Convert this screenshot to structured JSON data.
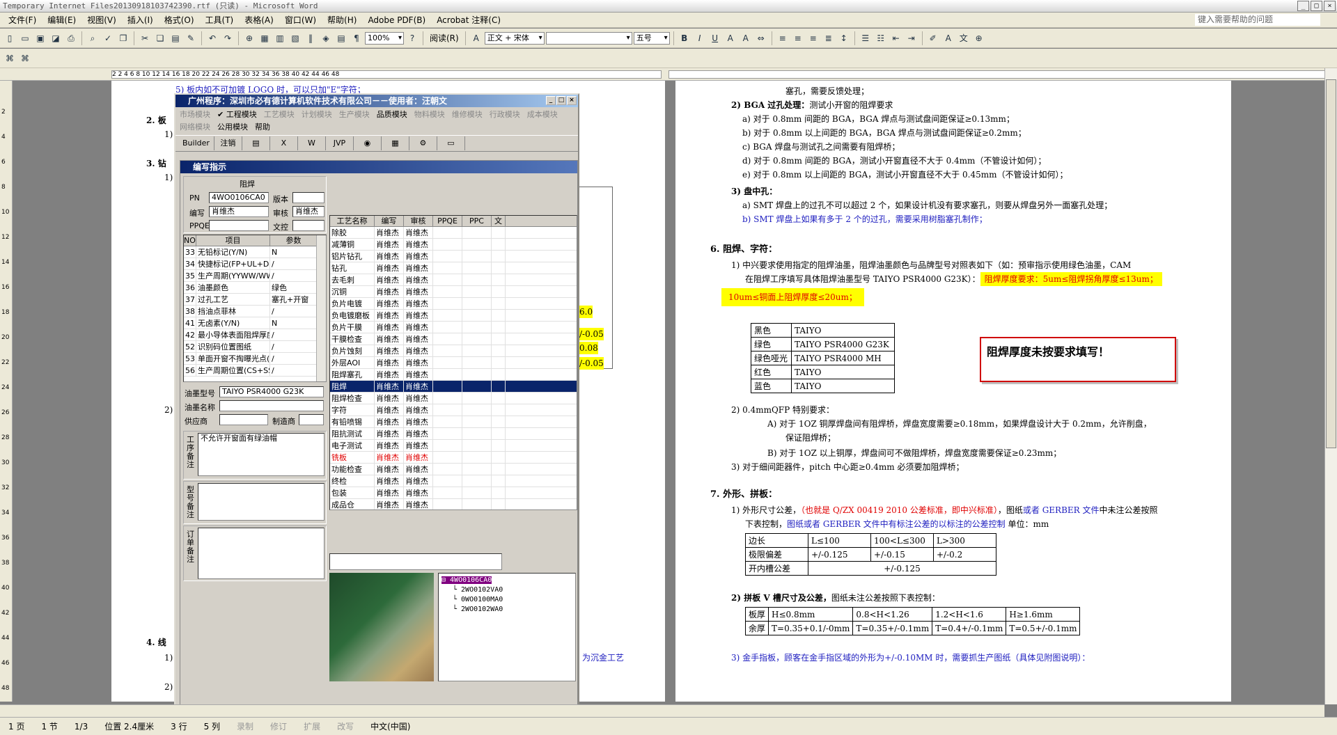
{
  "window": {
    "title": "Temporary Internet Files20130918103742390.rtf (只读) - Microsoft Word",
    "help_placeholder": "键入需要帮助的问题"
  },
  "menu": [
    "文件(F)",
    "编辑(E)",
    "视图(V)",
    "插入(I)",
    "格式(O)",
    "工具(T)",
    "表格(A)",
    "窗口(W)",
    "帮助(H)",
    "Adobe PDF(B)",
    "Acrobat 注释(C)"
  ],
  "toolbar": {
    "zoom": "100%",
    "read": "阅读(R)",
    "style": "正文 + 宋体",
    "font": "",
    "size": "五号"
  },
  "ruler_numbers": "2   2   4   6   8   10  12  14  16  18  20  22  24  26  28  30  32  34  36  38  40  42  44  46  48",
  "vruler": [
    "2",
    "4",
    "6",
    "8",
    "10",
    "12",
    "14",
    "16",
    "18",
    "20",
    "22",
    "24",
    "26",
    "28",
    "30",
    "32",
    "34",
    "36",
    "38",
    "40",
    "42",
    "44",
    "46",
    "48"
  ],
  "left_page": {
    "lines": [
      "5) 板内如不可加镀 LOGO 时，可以只加\"E\"字符；",
      "2. 板",
      "1)",
      "3. 钻",
      "1)",
      "2)",
      "4. 线",
      "1)",
      "2)"
    ],
    "tail": "为沉金工艺",
    "frag": [
      "6.0",
      "/-0.05",
      "0.08",
      "/-0.05"
    ]
  },
  "right_page": {
    "l1": "塞孔，需要反馈处理；",
    "l2a": "2)  BGA 过孔处理：",
    "l2b": "测试小开窗的阻焊要求",
    "l3": "a) 对于 0.8mm 间距的 BGA，BGA 焊点与测试盘间距保证≥0.13mm；",
    "l4": "b) 对于 0.8mm 以上间距的 BGA，BGA 焊点与测试盘间距保证≥0.2mm；",
    "l5": "c) BGA 焊盘与测试孔之间需要有阻焊桥；",
    "l6": "d) 对于 0.8mm 间距的 BGA，测试小开窗直径不大于 0.4mm（不管设计如何）；",
    "l7": "e) 对于 0.8mm 以上间距的 BGA，测试小开窗直径不大于 0.45mm（不管设计如何）；",
    "l8": "3)  盘中孔：",
    "l9": "a) SMT 焊盘上的过孔不可以超过 2 个，如果设计机没有要求塞孔，则要从焊盘另外一面塞孔处理；",
    "l10": "b) SMT 焊盘上如果有多于 2 个的过孔，需要采用树脂塞孔制作；",
    "h6": "6.  阻焊、字符：",
    "l11": "1)  中兴要求使用指定的阻焊油墨，阻焊油墨颜色与品牌型号对照表如下（如：预审指示使用绿色油墨，CAM",
    "l12a": "在阻焊工序填写具体阻焊油墨型号 TAIYO  PSR4000 G23K）：",
    "l12b": "阻焊厚度要求：5um≤阻焊拐角厚度≤13um；",
    "l13": "10um≤铜面上阻焊厚度≤20um；",
    "ink_table": [
      [
        "黑色",
        "TAIYO"
      ],
      [
        "绿色",
        "TAIYO   PSR4000 G23K"
      ],
      [
        "绿色哑光",
        "TAIYO   PSR4000 MH"
      ],
      [
        "红色",
        "TAIYO"
      ],
      [
        "蓝色",
        "TAIYO"
      ]
    ],
    "callout": "阻焊厚度未按要求填写！",
    "l14": "2)  0.4mmQFP 特别要求：",
    "l15": "A) 对于 1OZ 铜厚焊盘间有阻焊桥，焊盘宽度需要≥0.18mm，如果焊盘设计大于 0.2mm，允许削盘，",
    "l16": "保证阻焊桥；",
    "l17": "B) 对于 1OZ 以上铜厚，焊盘间可不做阻焊桥，焊盘宽度需要保证≥0.23mm；",
    "l18": "3)  对于细间距器件，pitch 中心距≥0.4mm 必须要加阻焊桥；",
    "h7": "7.  外形、拼板：",
    "l19a": "1)  外形尺寸公差，",
    "l19b": "（也就是 Q/ZX 00419 2010 公差标准，即中兴标准）",
    "l19c": "，图纸",
    "l19d": "或者 GERBER 文件",
    "l19e": "中未注公差按照",
    "l20a": "下表控制，",
    "l20b": "图纸或者 GERBER 文件中有标注公差的以标注的公差控制",
    "l20c": "  单位：mm",
    "tol_table": [
      [
        "边长",
        "L≤100",
        "100<L≤300",
        "L>300"
      ],
      [
        "极限偏差",
        "+/-0.125",
        "+/-0.15",
        "+/-0.2"
      ],
      [
        "开内槽公差",
        "+/-0.125"
      ]
    ],
    "l21a": "2)  拼板 V 槽尺寸及公差，",
    "l21b": "图纸未注公差按照下表控制：",
    "v_table": [
      [
        "板厚",
        "H≤0.8mm",
        "0.8<H<1.26",
        "1.2<H<1.6",
        "H≥1.6mm"
      ],
      [
        "余厚",
        "T=0.35+0.1/-0mm",
        "T=0.35+/-0.1mm",
        "T=0.4+/-0.1mm",
        "T=0.5+/-0.1mm"
      ]
    ],
    "l22": "3)  金手指板，顾客在金手指区域的外形为+/-0.10MM 时，需要抓生产图纸（具体见附图说明）："
  },
  "dialog": {
    "title": "广州程序：深圳市必有德计算机软件技术有限公司－－使用者：汪朝文",
    "menu": [
      [
        "市场模块",
        false
      ],
      [
        "✔ 工程模块",
        true
      ],
      [
        "工艺模块",
        false
      ],
      [
        "计划模块",
        false
      ],
      [
        "生产模块",
        false
      ],
      [
        "品质模块",
        true
      ],
      [
        "物料模块",
        false
      ],
      [
        "维修模块",
        false
      ],
      [
        "行政模块",
        false
      ],
      [
        "成本模块",
        false
      ],
      [
        "网络模块",
        false
      ],
      [
        "公用模块",
        true
      ],
      [
        "帮助",
        true
      ]
    ],
    "tools": [
      "Builder",
      "注销",
      "▤",
      "X",
      "W",
      "JVP",
      "◉",
      "▦",
      "⚙",
      "▭"
    ],
    "sub_title": "编写指示",
    "section": "阻焊",
    "pn_label": "PN",
    "pn": "4WO0106CA0",
    "ver_label": "版本",
    "ver": "",
    "author_label": "编写",
    "author": "肖维杰",
    "review_label": "审核",
    "review": "肖维杰",
    "ppqe_label": "PPQE",
    "ppqe": "",
    "doc_label": "文控",
    "doc": "",
    "params_hdr": [
      "NO",
      "项目",
      "参数"
    ],
    "params": [
      [
        "33",
        "无铅标记(Y/N)",
        "N"
      ],
      [
        "34",
        "快捷标记(FP+UL+DateCo",
        "/"
      ],
      [
        "35",
        "生产周期(YYWW/WWYY)",
        "/"
      ],
      [
        "36",
        "油墨颜色",
        "绿色"
      ],
      [
        "37",
        "过孔工艺",
        "塞孔+开窗"
      ],
      [
        "38",
        "挡油点菲林",
        "/"
      ],
      [
        "41",
        "无卤素(Y/N)",
        "N"
      ],
      [
        "42",
        "最小导体表面阻焊厚度",
        "/"
      ],
      [
        "52",
        "识别码位置图纸",
        "/"
      ],
      [
        "53",
        "单面开窗不掏曝光点(CS",
        "/"
      ],
      [
        "56",
        "生产周期位置(CS+SS)",
        "/"
      ]
    ],
    "ink_label": "油墨型号",
    "ink": "TAIYO   PSR4000 G23K",
    "inkname_label": "油墨名称",
    "inkname": "",
    "supplier_label": "供应商",
    "maker_label": "制造商",
    "note1_label": "工序备注",
    "note1": "不允许开窗面有绿油帽",
    "note2_label": "型号备注",
    "note3_label": "订单备注",
    "proc_hdr": [
      "工艺名称",
      "编写",
      "审核",
      "PPQE",
      "PPC",
      "文"
    ],
    "procs": [
      "除胶",
      "减薄铜",
      "铝片钻孔",
      "钻孔",
      "去毛刺",
      "沉铜",
      "负片电镀",
      "负电镀磨板",
      "负片干膜",
      "干膜检查",
      "负片蚀刻",
      "外层AOI",
      "阻焊塞孔",
      "阻焊",
      "阻焊检查",
      "字符",
      "有铅喷锡",
      "阻抗测试",
      "电子测试",
      "铣板",
      "功能检查",
      "终检",
      "包装",
      "成品仓"
    ],
    "proc_person": "肖维杰",
    "tree": [
      "4WO0106CA0",
      "2WO0102VA0",
      "0WO0100MA0",
      "2WO0102WA0"
    ]
  },
  "status": [
    "1 页",
    "1 节",
    "1/3",
    "位置 2.4厘米",
    "3 行",
    "5 列",
    "录制",
    "修订",
    "扩展",
    "改写",
    "中文(中国)"
  ]
}
